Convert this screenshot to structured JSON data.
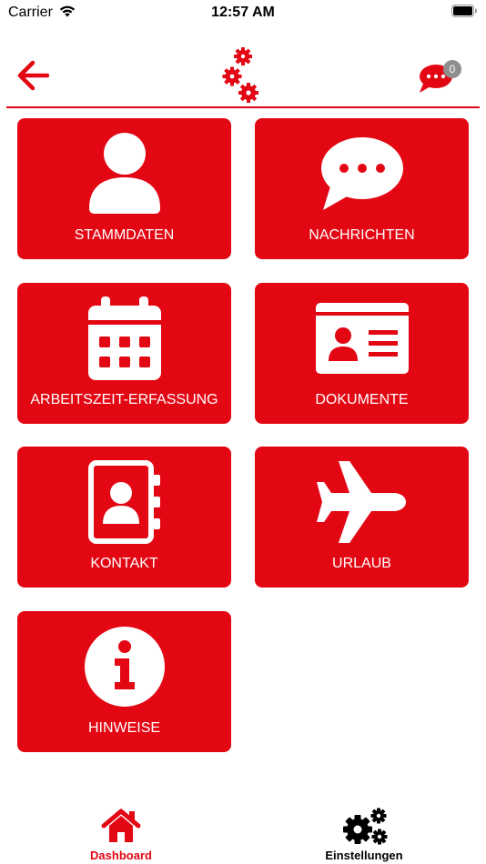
{
  "status_bar": {
    "carrier": "Carrier",
    "time": "12:57 AM"
  },
  "header": {
    "back_icon": "arrow-left-icon",
    "logo_icon": "gears-logo-icon",
    "chat_badge_count": "0"
  },
  "tiles": [
    {
      "label": "STAMMDATEN",
      "icon": "person-icon"
    },
    {
      "label": "NACHRICHTEN",
      "icon": "speech-bubble-icon"
    },
    {
      "label": "ARBEITSZEIT-ERFASSUNG",
      "icon": "calendar-icon"
    },
    {
      "label": "DOKUMENTE",
      "icon": "id-card-icon"
    },
    {
      "label": "KONTAKT",
      "icon": "address-book-icon"
    },
    {
      "label": "URLAUB",
      "icon": "airplane-icon"
    },
    {
      "label": "HINWEISE",
      "icon": "info-icon"
    }
  ],
  "tab_bar": {
    "dashboard_label": "Dashboard",
    "settings_label": "Einstellungen"
  },
  "colors": {
    "accent": "#e30613",
    "badge": "#8e8e8e",
    "tile_text": "#ffffff"
  }
}
